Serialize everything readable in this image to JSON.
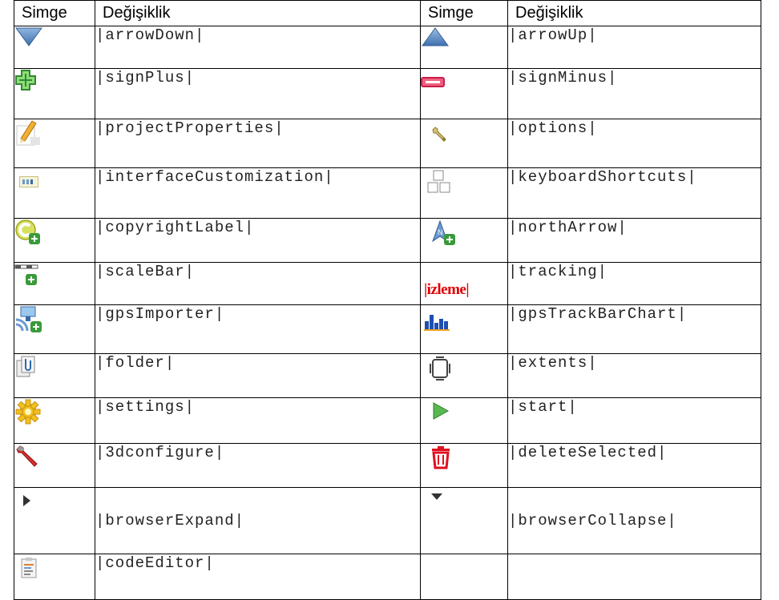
{
  "header": {
    "col_icon": "Simge",
    "col_change": "Değişiklik",
    "col_icon2": "Simge",
    "col_change2": "Değişiklik"
  },
  "rows": [
    {
      "left_icon": "arrow-down-icon",
      "left_code": "|arrowDown|",
      "right_icon": "arrow-up-icon",
      "right_code": "|arrowUp|"
    },
    {
      "left_icon": "sign-plus-icon",
      "left_code": "|signPlus|",
      "right_icon": "sign-minus-icon",
      "right_code": "|signMinus|"
    },
    {
      "left_icon": "project-properties-icon",
      "left_code": "|projectProperties|",
      "right_icon": "options-wrench-icon",
      "right_code": "|options|"
    },
    {
      "left_icon": "interface-customization-icon",
      "left_code": "|interfaceCustomization|",
      "right_icon": "keyboard-shortcuts-icon",
      "right_code": "|keyboardShortcuts|"
    },
    {
      "left_icon": "copyright-label-icon",
      "left_code": "|copyrightLabel|",
      "right_icon": "north-arrow-icon",
      "right_code": "|northArrow|"
    },
    {
      "left_icon": "scale-bar-icon",
      "left_code": "|scaleBar|",
      "right_icon": "tracking-text-image",
      "right_image_text": "|izleme|",
      "right_code": "|tracking|"
    },
    {
      "left_icon": "gps-importer-icon",
      "left_code": "|gpsImporter|",
      "right_icon": "gps-track-bar-chart-icon",
      "right_code": "|gpsTrackBarChart|"
    },
    {
      "left_icon": "folder-icon",
      "left_code": "|folder|",
      "right_icon": "extents-icon",
      "right_code": "|extents|"
    },
    {
      "left_icon": "settings-gear-icon",
      "left_code": "|settings|",
      "right_icon": "start-play-icon",
      "right_code": "|start|"
    },
    {
      "left_icon": "3d-configure-wrench-icon",
      "left_code": "|3dconfigure|",
      "right_icon": "delete-selected-trash-icon",
      "right_code": "|deleteSelected|"
    },
    {
      "left_icon": "browser-expand-triangle-icon",
      "left_code": "|browserExpand|",
      "right_icon": "browser-collapse-triangle-icon",
      "right_code": "|browserCollapse|"
    },
    {
      "left_icon": "code-editor-icon",
      "left_code": "|codeEditor|",
      "right_icon": "",
      "right_code": ""
    }
  ],
  "colors": {
    "accent_blue": "#5b8fc7",
    "plus_green": "#3a9a3a",
    "minus_red": "#e0305a",
    "red_text": "#e00000"
  }
}
